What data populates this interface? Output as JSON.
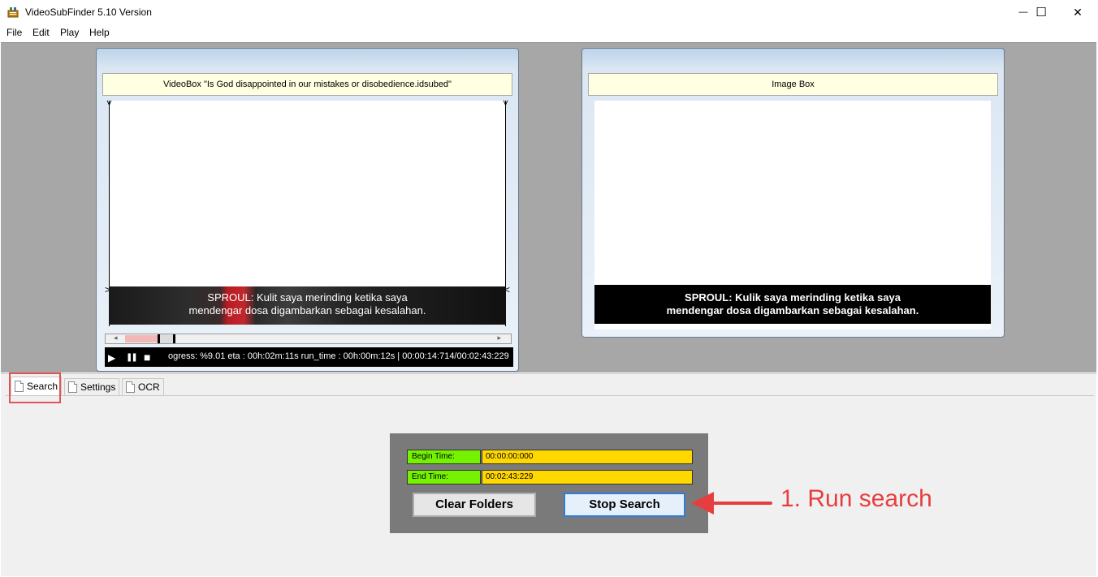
{
  "window": {
    "title": "VideoSubFinder 5.10 Version",
    "minimize_glyph": "—",
    "maximize_glyph": "☐",
    "close_glyph": "✕"
  },
  "menu": [
    {
      "label": "File"
    },
    {
      "label": "Edit"
    },
    {
      "label": "Play"
    },
    {
      "label": "Help"
    }
  ],
  "video_box": {
    "caption": "VideoBox \"Is God disappointed in our mistakes or disobedience.idsubed\"",
    "subtitle_lines": [
      "SPROUL: Kulit saya merinding ketika saya",
      "mendengar dosa digambarkan sebagai kesalahan."
    ],
    "progress_text": "ogress: %9.01 eta : 00h:02m:11s run_time : 00h:00m:12s   |   00:00:14:714/00:02:43:229",
    "play_glyph": "▶",
    "pause_glyph": "❚❚",
    "stop_glyph": "■"
  },
  "image_box": {
    "caption": "Image Box",
    "subtitle_lines": [
      "SPROUL: Kulik saya merinding ketika saya",
      "mendengar dosa digambarkan sebagai kesalahan."
    ]
  },
  "tabs": [
    {
      "label": "Search"
    },
    {
      "label": "Settings"
    },
    {
      "label": "OCR"
    }
  ],
  "search_panel": {
    "begin_label": "Begin Time:",
    "begin_value": "00:00:00:000",
    "end_label": "End Time:",
    "end_value": "00:02:43:229",
    "clear_label": "Clear Folders",
    "stop_label": "Stop Search"
  },
  "annotation": {
    "text": "1. Run search",
    "color": "#e63e3e"
  },
  "colors": {
    "background_gray": "#a7a7a7",
    "label_green": "#74f200",
    "field_yellow": "#ffd800",
    "annotation_red": "#e63e3e"
  }
}
